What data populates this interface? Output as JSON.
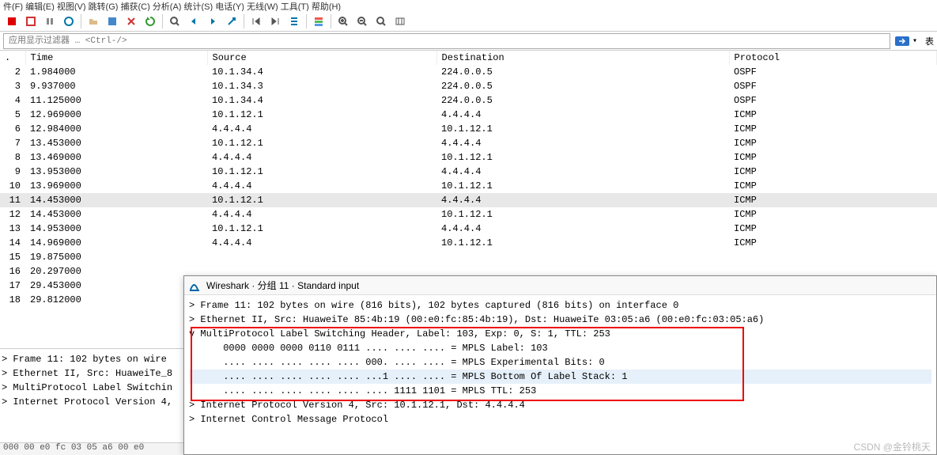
{
  "menubar": "件(F)  编辑(E)  视图(V)  跳转(G)  捕获(C)  分析(A)  统计(S)  电话(Y)  无线(W)  工具(T)  帮助(H)",
  "filter": {
    "placeholder": "应用显示过滤器 … <Ctrl-/>"
  },
  "columns": {
    "no": ".",
    "time": "Time",
    "src": "Source",
    "dst": "Destination",
    "proto": "Protocol"
  },
  "packets": [
    {
      "no": "2",
      "time": "1.984000",
      "src": "10.1.34.4",
      "dst": "224.0.0.5",
      "proto": "OSPF"
    },
    {
      "no": "3",
      "time": "9.937000",
      "src": "10.1.34.3",
      "dst": "224.0.0.5",
      "proto": "OSPF"
    },
    {
      "no": "4",
      "time": "11.125000",
      "src": "10.1.34.4",
      "dst": "224.0.0.5",
      "proto": "OSPF"
    },
    {
      "no": "5",
      "time": "12.969000",
      "src": "10.1.12.1",
      "dst": "4.4.4.4",
      "proto": "ICMP"
    },
    {
      "no": "6",
      "time": "12.984000",
      "src": "4.4.4.4",
      "dst": "10.1.12.1",
      "proto": "ICMP"
    },
    {
      "no": "7",
      "time": "13.453000",
      "src": "10.1.12.1",
      "dst": "4.4.4.4",
      "proto": "ICMP"
    },
    {
      "no": "8",
      "time": "13.469000",
      "src": "4.4.4.4",
      "dst": "10.1.12.1",
      "proto": "ICMP"
    },
    {
      "no": "9",
      "time": "13.953000",
      "src": "10.1.12.1",
      "dst": "4.4.4.4",
      "proto": "ICMP"
    },
    {
      "no": "10",
      "time": "13.969000",
      "src": "4.4.4.4",
      "dst": "10.1.12.1",
      "proto": "ICMP"
    },
    {
      "no": "11",
      "time": "14.453000",
      "src": "10.1.12.1",
      "dst": "4.4.4.4",
      "proto": "ICMP",
      "sel": true
    },
    {
      "no": "12",
      "time": "14.453000",
      "src": "4.4.4.4",
      "dst": "10.1.12.1",
      "proto": "ICMP"
    },
    {
      "no": "13",
      "time": "14.953000",
      "src": "10.1.12.1",
      "dst": "4.4.4.4",
      "proto": "ICMP"
    },
    {
      "no": "14",
      "time": "14.969000",
      "src": "4.4.4.4",
      "dst": "10.1.12.1",
      "proto": "ICMP"
    },
    {
      "no": "15",
      "time": "19.875000",
      "src": "",
      "dst": "",
      "proto": ""
    },
    {
      "no": "16",
      "time": "20.297000",
      "src": "",
      "dst": "",
      "proto": ""
    },
    {
      "no": "17",
      "time": "29.453000",
      "src": "",
      "dst": "",
      "proto": ""
    },
    {
      "no": "18",
      "time": "29.812000",
      "src": "",
      "dst": "",
      "proto": ""
    }
  ],
  "lowerLeft": [
    "Frame 11: 102 bytes on wire",
    "Ethernet II, Src: HuaweiTe_8",
    "MultiProtocol Label Switchin",
    "Internet Protocol Version 4,"
  ],
  "bytesbar": "000  00 e0 fc 03 05 a6 00 e0",
  "popup": {
    "title": "Wireshark · 分组 11 · Standard input",
    "lines": [
      {
        "t": ">",
        "txt": "Frame 11: 102 bytes on wire (816 bits), 102 bytes captured (816 bits) on interface 0"
      },
      {
        "t": ">",
        "txt": "Ethernet II, Src: HuaweiTe 85:4b:19 (00:e0:fc:85:4b:19), Dst: HuaweiTe 03:05:a6 (00:e0:fc:03:05:a6)"
      },
      {
        "t": "v",
        "txt": "MultiProtocol Label Switching Header, Label: 103, Exp: 0, S: 1, TTL: 253"
      },
      {
        "t": " ",
        "txt": "    0000 0000 0000 0110 0111 .... .... .... = MPLS Label: 103"
      },
      {
        "t": " ",
        "txt": "    .... .... .... .... .... 000. .... .... = MPLS Experimental Bits: 0"
      },
      {
        "t": " ",
        "txt": "    .... .... .... .... .... ...1 .... .... = MPLS Bottom Of Label Stack: 1",
        "hl": true
      },
      {
        "t": " ",
        "txt": "    .... .... .... .... .... .... 1111 1101 = MPLS TTL: 253"
      },
      {
        "t": ">",
        "txt": "Internet Protocol Version 4, Src: 10.1.12.1, Dst: 4.4.4.4"
      },
      {
        "t": ">",
        "txt": "Internet Control Message Protocol"
      }
    ]
  },
  "watermark": "CSDN @金铃桃天",
  "arrowExpr": "表"
}
